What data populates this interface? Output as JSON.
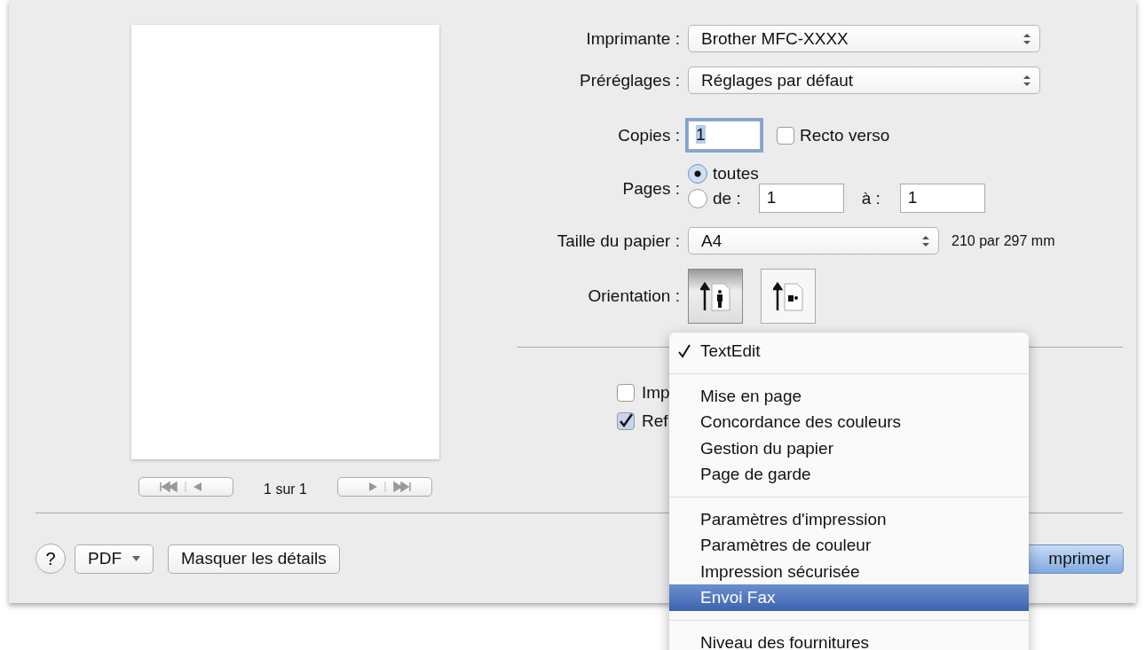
{
  "preview": {
    "page_indicator": "1 sur 1"
  },
  "form": {
    "printer": {
      "label": "Imprimante :",
      "value": "Brother MFC-XXXX"
    },
    "presets": {
      "label": "Préréglages :",
      "value": "Réglages par défaut"
    },
    "copies": {
      "label": "Copies :",
      "value": "1",
      "focused": true
    },
    "two_sided": {
      "label": "Recto verso",
      "checked": false
    },
    "pages": {
      "label": "Pages :",
      "options": [
        {
          "label": "toutes",
          "selected": true
        },
        {
          "label": "de :",
          "selected": false
        }
      ],
      "from": "1",
      "to_label": "à :",
      "to": "1"
    },
    "paper_size": {
      "label": "Taille du papier :",
      "value": "A4",
      "dimensions": "210 par 297 mm"
    },
    "orientation": {
      "label": "Orientation :",
      "options": [
        {
          "kind": "portrait",
          "selected": true
        },
        {
          "kind": "landscape",
          "selected": false
        }
      ]
    }
  },
  "options": [
    {
      "label": "Imp",
      "checked": false
    },
    {
      "label": "Ref",
      "checked": true
    }
  ],
  "footer": {
    "help": "?",
    "pdf": "PDF",
    "details": "Masquer les détails",
    "print": "mprimer"
  },
  "menu": {
    "groups": [
      [
        {
          "label": "TextEdit",
          "checked": true,
          "selected": false
        }
      ],
      [
        {
          "label": "Mise en page",
          "checked": false,
          "selected": false
        },
        {
          "label": "Concordance des couleurs",
          "checked": false,
          "selected": false
        },
        {
          "label": "Gestion du papier",
          "checked": false,
          "selected": false
        },
        {
          "label": "Page de garde",
          "checked": false,
          "selected": false
        }
      ],
      [
        {
          "label": "Paramètres d'impression",
          "checked": false,
          "selected": false
        },
        {
          "label": "Paramètres de couleur",
          "checked": false,
          "selected": false
        },
        {
          "label": "Impression sécurisée",
          "checked": false,
          "selected": false
        },
        {
          "label": "Envoi Fax",
          "checked": false,
          "selected": true
        }
      ],
      [
        {
          "label": "Niveau des fournitures",
          "checked": false,
          "selected": false
        }
      ]
    ]
  }
}
